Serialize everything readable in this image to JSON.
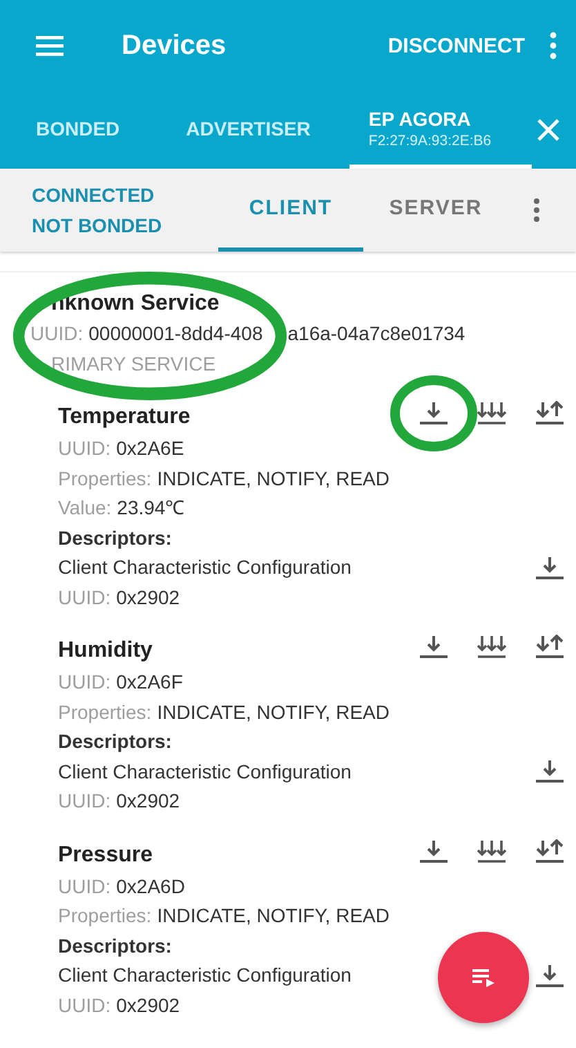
{
  "app_bar": {
    "title": "Devices",
    "action": "DISCONNECT"
  },
  "tabs": [
    {
      "label": "BONDED",
      "selected": false
    },
    {
      "label": "ADVERTISER",
      "selected": false
    },
    {
      "label": "EP AGORA",
      "address": "F2:27:9A:93:2E:B6",
      "selected": true
    }
  ],
  "connection": {
    "state": "CONNECTED",
    "bond": "NOT BONDED"
  },
  "sub_tabs": [
    {
      "label": "CLIENT",
      "selected": true
    },
    {
      "label": "SERVER",
      "selected": false
    }
  ],
  "service": {
    "name": "nknown Service",
    "uuid_label": "UUID:",
    "uuid_parts": [
      "00000001-8dd4-408",
      "a16a-04a7c8e01734"
    ],
    "type": "RIMARY SERVICE"
  },
  "characteristics": [
    {
      "name": "Temperature",
      "uuid_label": "UUID:",
      "uuid": "0x2A6E",
      "properties_label": "Properties:",
      "properties": "INDICATE, NOTIFY, READ",
      "value_label": "Value:",
      "value": "23.94℃",
      "descriptors_label": "Descriptors:",
      "descriptors": [
        {
          "name": "Client Characteristic Configuration",
          "uuid_label": "UUID:",
          "uuid": "0x2902"
        }
      ]
    },
    {
      "name": "Humidity",
      "uuid_label": "UUID:",
      "uuid": "0x2A6F",
      "properties_label": "Properties:",
      "properties": "INDICATE, NOTIFY, READ",
      "descriptors_label": "Descriptors:",
      "descriptors": [
        {
          "name": "Client Characteristic Configuration",
          "uuid_label": "UUID:",
          "uuid": "0x2902"
        }
      ]
    },
    {
      "name": "Pressure",
      "uuid_label": "UUID:",
      "uuid": "0x2A6D",
      "properties_label": "Properties:",
      "properties": "INDICATE, NOTIFY, READ",
      "descriptors_label": "Descriptors:",
      "descriptors": [
        {
          "name": "Client Characteristic Configuration",
          "uuid_label": "UUID:",
          "uuid": "0x2902"
        }
      ]
    }
  ]
}
